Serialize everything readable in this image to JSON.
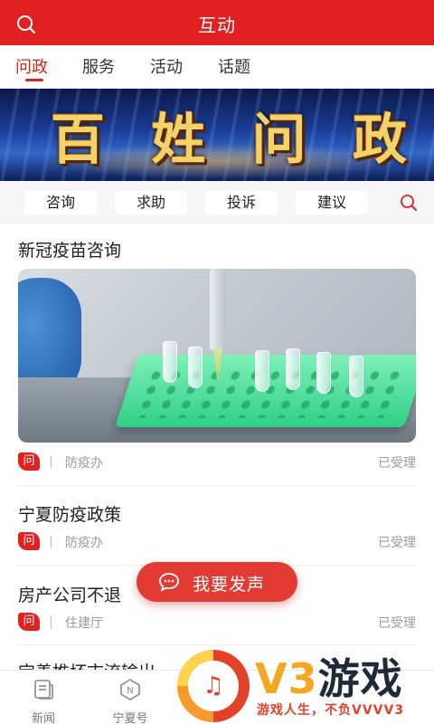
{
  "header": {
    "title": "互动"
  },
  "tabs": [
    {
      "label": "问政",
      "active": true
    },
    {
      "label": "服务"
    },
    {
      "label": "活动"
    },
    {
      "label": "话题"
    }
  ],
  "banner": {
    "title_chars": [
      "百",
      "姓",
      "问",
      "政"
    ]
  },
  "chips": [
    "咨询",
    "求助",
    "投诉",
    "建议"
  ],
  "feed": [
    {
      "title": "新冠疫苗咨询",
      "badge": "问",
      "separator": "|",
      "dept": "防疫办",
      "status": "已受理",
      "has_image": true
    },
    {
      "title": "宁夏防疫政策",
      "badge": "问",
      "separator": "|",
      "dept": "防疫办",
      "status": "已受理"
    },
    {
      "title": "房产公司不退",
      "badge": "问",
      "separator": "|",
      "dept": "住建厅",
      "status": "已受理"
    },
    {
      "title": "宝善推坏市流输出"
    }
  ],
  "fab": {
    "label": "我要发声"
  },
  "bottom_nav": [
    {
      "label": "新闻",
      "icon": "news-icon"
    },
    {
      "label": "宁夏号",
      "icon": "ningxia-hao-icon"
    }
  ],
  "watermark": {
    "logo": "V3游戏",
    "logo_v3": "V3",
    "logo_yx": "游戏",
    "slogan": "游戏人生，不负VVVV3"
  },
  "colors": {
    "brand_red": "#e02121",
    "tab_active": "#d6251f",
    "fab": "#e23b33"
  }
}
